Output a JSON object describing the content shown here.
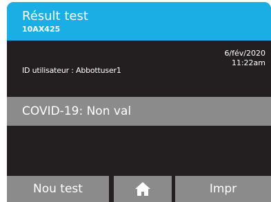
{
  "header": {
    "title": "Résult test",
    "subtitle": "10AX425"
  },
  "info": {
    "user_id": "ID utilisateur : Abbottuser1",
    "date": "6/fév/2020",
    "time": "11:22am"
  },
  "result": {
    "text": "COVID-19: Non val"
  },
  "footer": {
    "new_test_label": "Nou test",
    "home_icon": "home-icon",
    "print_label": "Impr"
  },
  "colors": {
    "header_bg": "#1aaee5",
    "screen_bg": "#231f20",
    "bar_bg": "#8b8b8b"
  }
}
